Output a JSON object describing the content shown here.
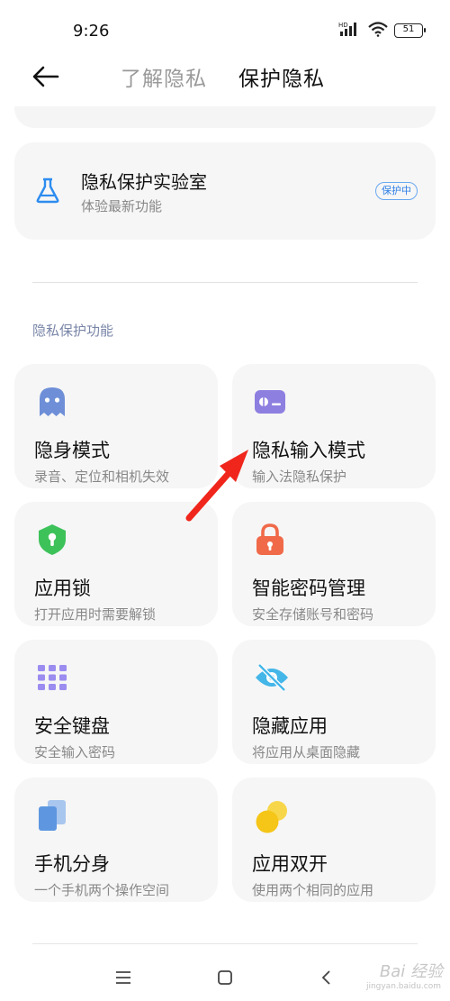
{
  "status_bar": {
    "time": "9:26",
    "network": "HD",
    "battery": "51"
  },
  "header": {
    "tab_understand": "了解隐私",
    "tab_protect": "保护隐私"
  },
  "lab": {
    "title": "隐私保护实验室",
    "subtitle": "体验最新功能",
    "badge": "保护中"
  },
  "section": {
    "title": "隐私保护功能"
  },
  "features": [
    {
      "title": "隐身模式",
      "subtitle": "录音、定位和相机失效",
      "icon": "ghost-icon",
      "color": "#6e8fd8"
    },
    {
      "title": "隐私输入模式",
      "subtitle": "输入法隐私保护",
      "icon": "private-input-icon",
      "color": "#8d7fe0"
    },
    {
      "title": "应用锁",
      "subtitle": "打开应用时需要解锁",
      "icon": "shield-lock-icon",
      "color": "#3dc25a"
    },
    {
      "title": "智能密码管理",
      "subtitle": "安全存储账号和密码",
      "icon": "padlock-icon",
      "color": "#f06a4a"
    },
    {
      "title": "安全键盘",
      "subtitle": "安全输入密码",
      "icon": "keypad-icon",
      "color": "#9b8cf0"
    },
    {
      "title": "隐藏应用",
      "subtitle": "将应用从桌面隐藏",
      "icon": "eye-off-icon",
      "color": "#44b6e8"
    },
    {
      "title": "手机分身",
      "subtitle": "一个手机两个操作空间",
      "icon": "dual-phone-icon",
      "color": "#5e97e0"
    },
    {
      "title": "应用双开",
      "subtitle": "使用两个相同的应用",
      "icon": "dual-app-icon",
      "color": "#f5c518"
    }
  ],
  "watermark": {
    "brand": "Bai 经验",
    "url": "jingyan.baidu.com"
  }
}
